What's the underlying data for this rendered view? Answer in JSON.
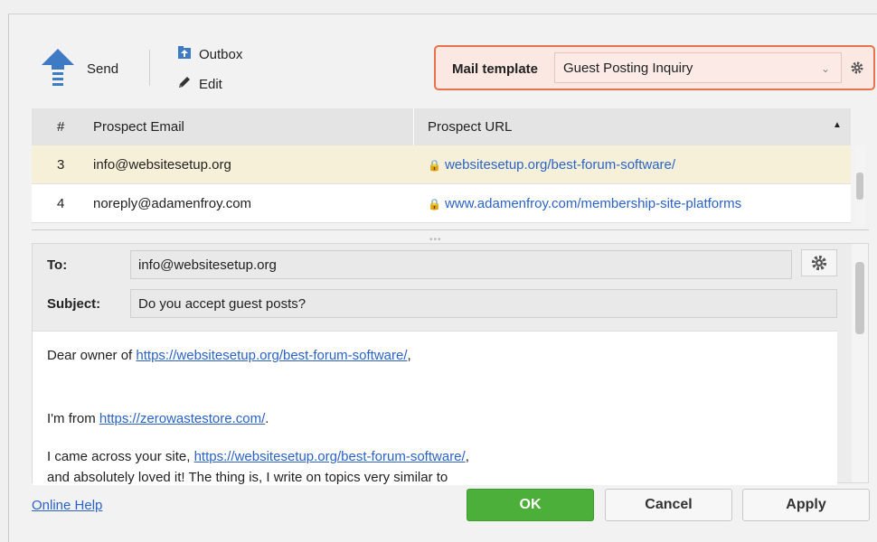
{
  "toolbar": {
    "send_label": "Send",
    "outbox_label": "Outbox",
    "edit_label": "Edit"
  },
  "template": {
    "label": "Mail template",
    "value": "Guest Posting Inquiry"
  },
  "grid": {
    "columns": [
      "#",
      "Prospect Email",
      "Prospect URL"
    ],
    "rows": [
      {
        "num": "3",
        "email": "info@websitesetup.org",
        "url": "websitesetup.org/best-forum-software/"
      },
      {
        "num": "4",
        "email": "noreply@adamenfroy.com",
        "url": "www.adamenfroy.com/membership-site-platforms"
      }
    ]
  },
  "compose": {
    "to_label": "To:",
    "to_value": "info@websitesetup.org",
    "subject_label": "Subject:",
    "subject_value": "Do you accept guest posts?",
    "line1_prefix": "Dear owner of ",
    "line1_link": "https://websitesetup.org/best-forum-software/",
    "line1_suffix": ",",
    "line2_prefix": "I'm  from ",
    "line2_link": "https://zerowastestore.com/",
    "line2_suffix": ".",
    "line3_prefix": "I came across your site, ",
    "line3_link": "https://websitesetup.org/best-forum-software/",
    "line3_suffix": ",",
    "line4": "and absolutely loved it! The thing is, I write on topics very similar to"
  },
  "footer": {
    "help": "Online Help",
    "ok": "OK",
    "cancel": "Cancel",
    "apply": "Apply"
  },
  "colors": {
    "accent_orange": "#e8734a",
    "ok_green": "#4caf3a",
    "link_blue": "#2b63c6",
    "selected_row": "#f7f0d8"
  }
}
